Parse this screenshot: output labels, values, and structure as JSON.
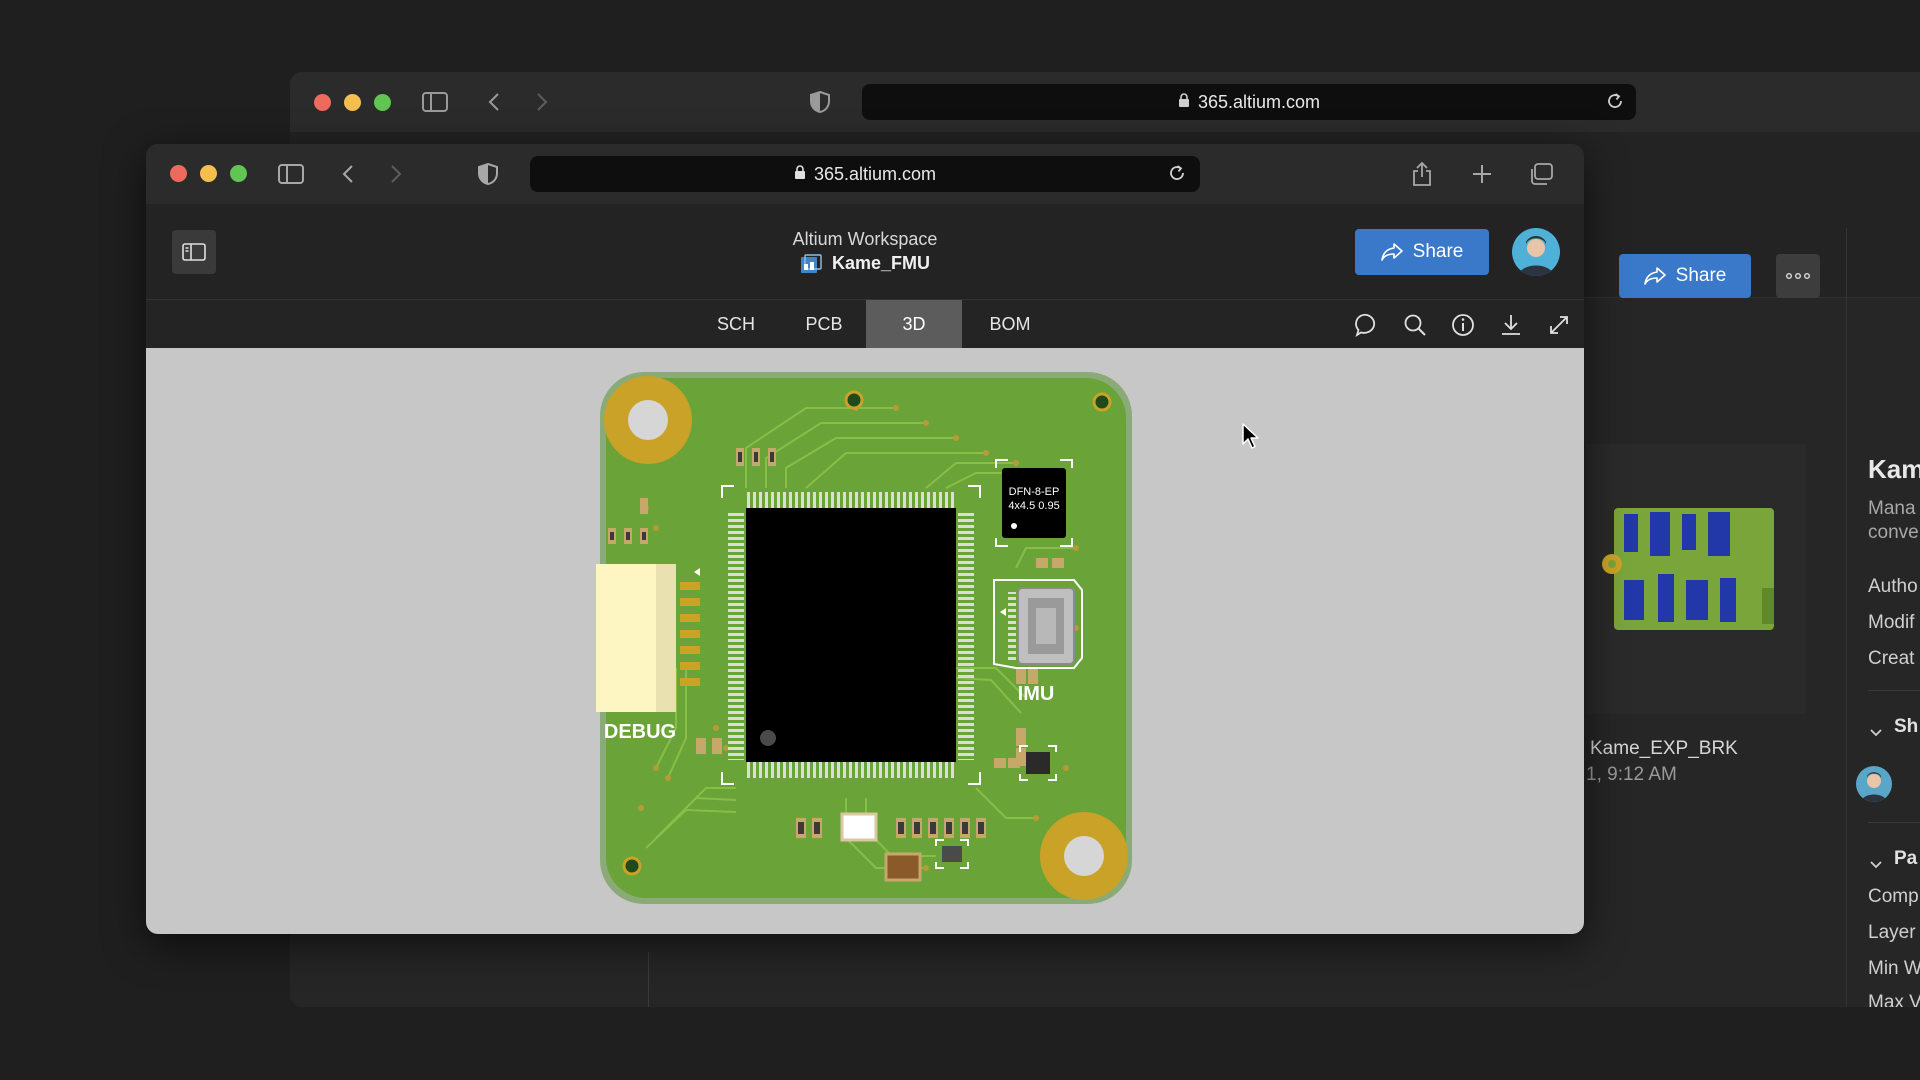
{
  "back_window": {
    "url": "365.altium.com",
    "share_label": "Share",
    "project_name": "Kame_EXP_BRK",
    "project_time": "1, 9:12 AM",
    "panel": {
      "title": "Kam",
      "desc_line1": "Mana",
      "desc_line2": "conve",
      "meta": [
        "Autho",
        "Modif",
        "Creat"
      ],
      "section_shared": "Sh",
      "section_params": "Pa",
      "params": [
        "Comp",
        "Layer",
        "Min W",
        "Max V"
      ]
    }
  },
  "front_window": {
    "url": "365.altium.com",
    "workspace": "Altium Workspace",
    "project": "Kame_FMU",
    "share_label": "Share",
    "tabs": [
      {
        "label": "SCH",
        "active": false
      },
      {
        "label": "PCB",
        "active": false
      },
      {
        "label": "3D",
        "active": true
      },
      {
        "label": "BOM",
        "active": false
      }
    ]
  },
  "pcb": {
    "chip_label_line1": "DFN-8-EP",
    "chip_label_line2": "4x4.5 0.95",
    "imu_label": "IMU",
    "debug_label": "DEBUG",
    "colors": {
      "board": "#6aa338",
      "edge": "#8aab78",
      "pad": "#c9a227",
      "chip": "#000000",
      "viewport": "#c7c7c7"
    }
  }
}
